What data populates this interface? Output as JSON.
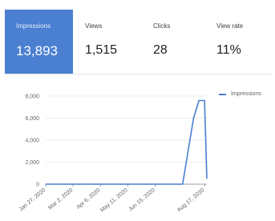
{
  "metrics": [
    {
      "label": "Impressions",
      "value": "13,893",
      "active": true
    },
    {
      "label": "Views",
      "value": "1,515",
      "active": false
    },
    {
      "label": "Clicks",
      "value": "28",
      "active": false
    },
    {
      "label": "View rate",
      "value": "11%",
      "active": false
    }
  ],
  "colors": {
    "accent": "#4a7fd1",
    "text": "#202124",
    "muted": "#5f6368"
  },
  "chart_data": {
    "type": "line",
    "series": [
      {
        "name": "Impressions",
        "x": [
          "2020-01-27",
          "2020-03-02",
          "2020-04-06",
          "2020-05-11",
          "2020-06-15",
          "2020-07-20",
          "2020-08-03",
          "2020-08-10",
          "2020-08-17",
          "2020-08-20"
        ],
        "values": [
          0,
          0,
          0,
          0,
          0,
          0,
          6000,
          7600,
          7600,
          500
        ]
      }
    ],
    "x_ticks": [
      "Jan 27, 2020",
      "Mar 2, 2020",
      "Apr 6, 2020",
      "May 11, 2020",
      "Jun 15, 2020",
      "Aug 17, 2020"
    ],
    "y_ticks": [
      "8,000",
      "6,000",
      "4,000",
      "2,000",
      "0"
    ],
    "ylim": [
      0,
      8000
    ],
    "legend": {
      "label": "Impressions",
      "position": "right"
    },
    "grid": true
  }
}
